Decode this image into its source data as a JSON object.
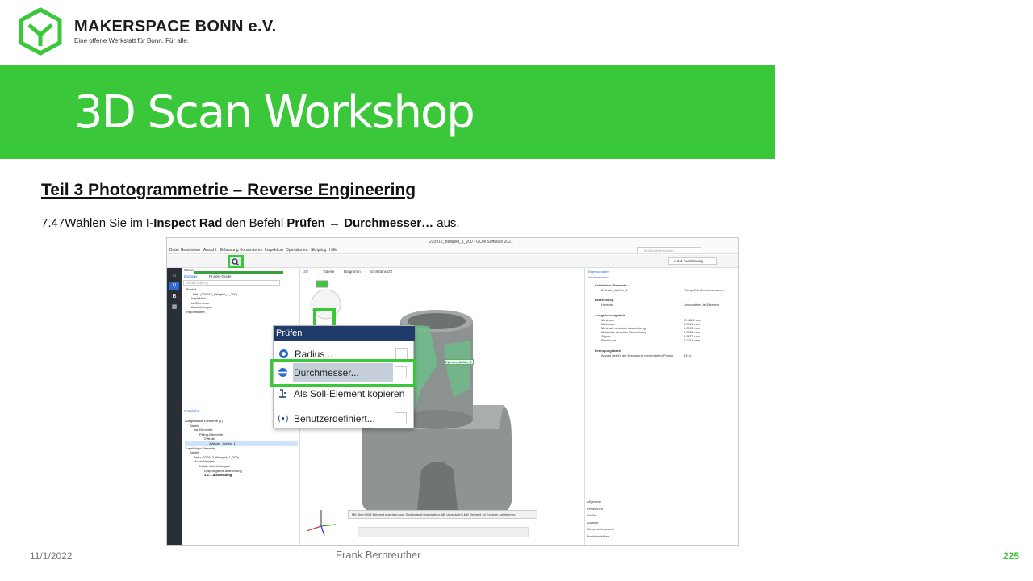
{
  "header": {
    "org_name": "MAKERSPACE BONN e.V.",
    "tagline": "Eine offene Werkstatt für Bonn. Für alle.",
    "title": "3D Scan Workshop"
  },
  "section_heading": "Teil 3  Photogrammetrie  – Reverse Engineering",
  "step": {
    "number": "7.47",
    "text_before": "Wählen Sie im ",
    "tool": "I-Inspect Rad",
    "text_mid": " den Befehl ",
    "command": "Prüfen",
    "arrow": "→",
    "sub_command": "Durchmesser…",
    "text_after": " aus."
  },
  "footer": {
    "date": "11/1/2022",
    "author": "Frank Bernreuther",
    "page": "225"
  },
  "colors": {
    "brand_green": "#3ac73a",
    "menu_header": "#1f3b6a"
  },
  "screenshot": {
    "window_title": "220912_Beispiel_1_200 - GOM Software 2021",
    "menus": [
      "Datei",
      "Bearbeiten",
      "Ansicht",
      "Erfassung",
      "Konstruieren",
      "Inspektion",
      "Operationen",
      "Skripting",
      "Hilfe"
    ],
    "search_placeholder": "Ist-Elemente suchen",
    "alignment_select": "3-2-1-Ausrichtung",
    "rail_icons": [
      "home-icon",
      "search-icon",
      "b-icon",
      "grid-icon"
    ],
    "left_panel": {
      "status_label": "Status",
      "tabs": [
        "Explorer",
        "Projekt-Guide"
      ],
      "search_placeholder": "Suchen (Strg+F)",
      "tree": [
        "Bauteil",
        "Netz (220912_Beispiel_1_200)",
        "Inspektion",
        "Ist-Elemente",
        "Ausrichtungen",
        "Reportseiten"
      ],
      "detail_tab": "Detail-Ex",
      "detail_tree": [
        "Ausgewählte Elemente (1)",
        "Bauteil",
        "Ist-Elemente",
        "Fitting-Elemente",
        "Zylinder",
        "Zylinder_Außen_1",
        "Zugehörige Elemente",
        "Bauteil",
        "Netz (220912_Beispiel_1_200)",
        "Ausrichtungen",
        "Initiale Ausrichtungen",
        "Ursprüngliche Ausrichtung",
        "3-2-1-Ausrichtung"
      ]
    },
    "viewport": {
      "tabs": [
        "3D",
        "Tabelle",
        "Diagramm",
        "Schnittansicht"
      ],
      "label_on_model": "Zylinder_Außen_1",
      "tooltip": "Mit Strg+LMB Element anzeigen und Sichtbarkeit umschalten. Mit Umschalt+LMB Element im Explorer selektieren."
    },
    "popup": {
      "header": "Prüfen",
      "items": [
        "Radius...",
        "Durchmesser...",
        "Als Soll-Element kopieren",
        "Benutzerdefiniert..."
      ]
    },
    "right_panel": {
      "tab": "Eigenschaften",
      "sub_tab": "Informationen",
      "selected_label": "Selektierte Elemente: 1",
      "selected_name": "Zylinder_Außen_1",
      "selected_type": "Fitting-Zylinder konstruieren",
      "calc_label": "Berechnung",
      "hint_label": "Hinweis",
      "hint_value": "Unbenutztes Ist-Element",
      "fit_label": "Ausgleichsergebnis",
      "fit_rows": [
        [
          "Minimum",
          "-0.0602 mm"
        ],
        [
          "Maximum",
          "0.0071 mm"
        ],
        [
          "Minimale absolute Abweichung",
          "0.0000 mm"
        ],
        [
          "Maximale absolute Abweichung",
          "0.0903 mm"
        ],
        [
          "Sigma",
          "0.0277 mm"
        ],
        [
          "Residuum",
          "0.0219 mm"
        ]
      ],
      "gen_label": "Erzeugungsbasis",
      "gen_row": [
        "Anzahl der für die Erzeugung verwendeten Punkte",
        "3314"
      ],
      "sections": [
        "Allgemein",
        "Fehlerchen",
        "Größe",
        "Anzeige",
        "Element-Keywords",
        "Punktstatistiken"
      ]
    }
  }
}
